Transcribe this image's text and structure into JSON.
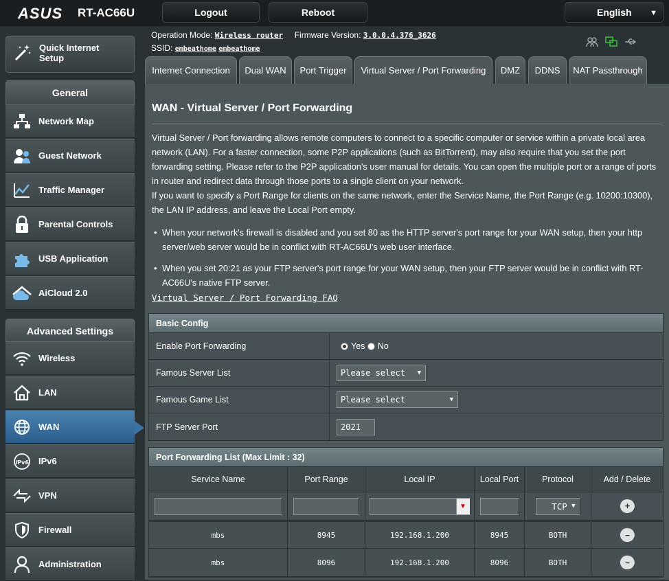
{
  "header": {
    "brand": "ASUS",
    "model": "RT-AC66U",
    "logout_label": "Logout",
    "reboot_label": "Reboot",
    "language": "English"
  },
  "info": {
    "operation_mode_label": "Operation Mode:",
    "operation_mode_value": "Wireless router",
    "firmware_label": "Firmware Version:",
    "firmware_value": "3.0.0.4.376_3626",
    "ssid_label": "SSID:",
    "ssid_values": [
      "embeathome",
      "embeathome"
    ]
  },
  "sidebar": {
    "qis_label": "Quick Internet Setup",
    "general_title": "General",
    "general_items": [
      {
        "label": "Network Map",
        "icon": "network-map-icon"
      },
      {
        "label": "Guest Network",
        "icon": "guest-network-icon"
      },
      {
        "label": "Traffic Manager",
        "icon": "traffic-manager-icon"
      },
      {
        "label": "Parental Controls",
        "icon": "parental-controls-icon"
      },
      {
        "label": "USB Application",
        "icon": "usb-application-icon"
      },
      {
        "label": "AiCloud 2.0",
        "icon": "aicloud-icon"
      }
    ],
    "advanced_title": "Advanced Settings",
    "advanced_items": [
      {
        "label": "Wireless",
        "icon": "wireless-icon"
      },
      {
        "label": "LAN",
        "icon": "lan-icon"
      },
      {
        "label": "WAN",
        "icon": "wan-icon",
        "active": true
      },
      {
        "label": "IPv6",
        "icon": "ipv6-icon"
      },
      {
        "label": "VPN",
        "icon": "vpn-icon"
      },
      {
        "label": "Firewall",
        "icon": "firewall-icon"
      },
      {
        "label": "Administration",
        "icon": "administration-icon"
      }
    ]
  },
  "tabs": [
    {
      "label": "Internet Connection"
    },
    {
      "label": "Dual WAN"
    },
    {
      "label": "Port Trigger"
    },
    {
      "label": "Virtual Server / Port Forwarding",
      "active": true
    },
    {
      "label": "DMZ"
    },
    {
      "label": "DDNS"
    },
    {
      "label": "NAT Passthrough"
    }
  ],
  "main": {
    "title": "WAN - Virtual Server / Port Forwarding",
    "desc1": "Virtual Server / Port forwarding allows remote computers to connect to a specific computer or service within a private local area network (LAN). For a faster connection, some P2P applications (such as BitTorrent), may also require that you set the port forwarding setting. Please refer to the P2P application's user manual for details. You can open the multiple port or a range of ports in router and redirect data through those ports to a single client on your network.",
    "desc2": "If you want to specify a Port Range for clients on the same network, enter the Service Name, the Port Range (e.g. 10200:10300), the LAN IP address, and leave the Local Port empty.",
    "bullet1": "When your network's firewall is disabled and you set 80 as the HTTP server's port range for your WAN setup, then your http server/web server would be in conflict with RT-AC66U's web user interface.",
    "bullet2": "When you set 20:21 as your FTP server's port range for your WAN setup, then your FTP server would be in conflict with RT-AC66U's native FTP server.",
    "faq_link": "Virtual Server / Port Forwarding FAQ"
  },
  "basic_config": {
    "title": "Basic Config",
    "enable_label": "Enable Port Forwarding",
    "yes_label": "Yes",
    "no_label": "No",
    "enabled": "Yes",
    "famous_server_label": "Famous Server List",
    "famous_server_value": "Please select",
    "famous_game_label": "Famous Game List",
    "famous_game_value": "Please select",
    "ftp_port_label": "FTP Server Port",
    "ftp_port_value": "2021"
  },
  "pf_list": {
    "title": "Port Forwarding List (Max Limit : 32)",
    "headers": [
      "Service Name",
      "Port Range",
      "Local IP",
      "Local Port",
      "Protocol",
      "Add / Delete"
    ],
    "new_protocol": "TCP",
    "rows": [
      {
        "service": "mbs",
        "port_range": "8945",
        "local_ip": "192.168.1.200",
        "local_port": "8945",
        "protocol": "BOTH"
      },
      {
        "service": "mbs",
        "port_range": "8096",
        "local_ip": "192.168.1.200",
        "local_port": "8096",
        "protocol": "BOTH"
      }
    ]
  }
}
